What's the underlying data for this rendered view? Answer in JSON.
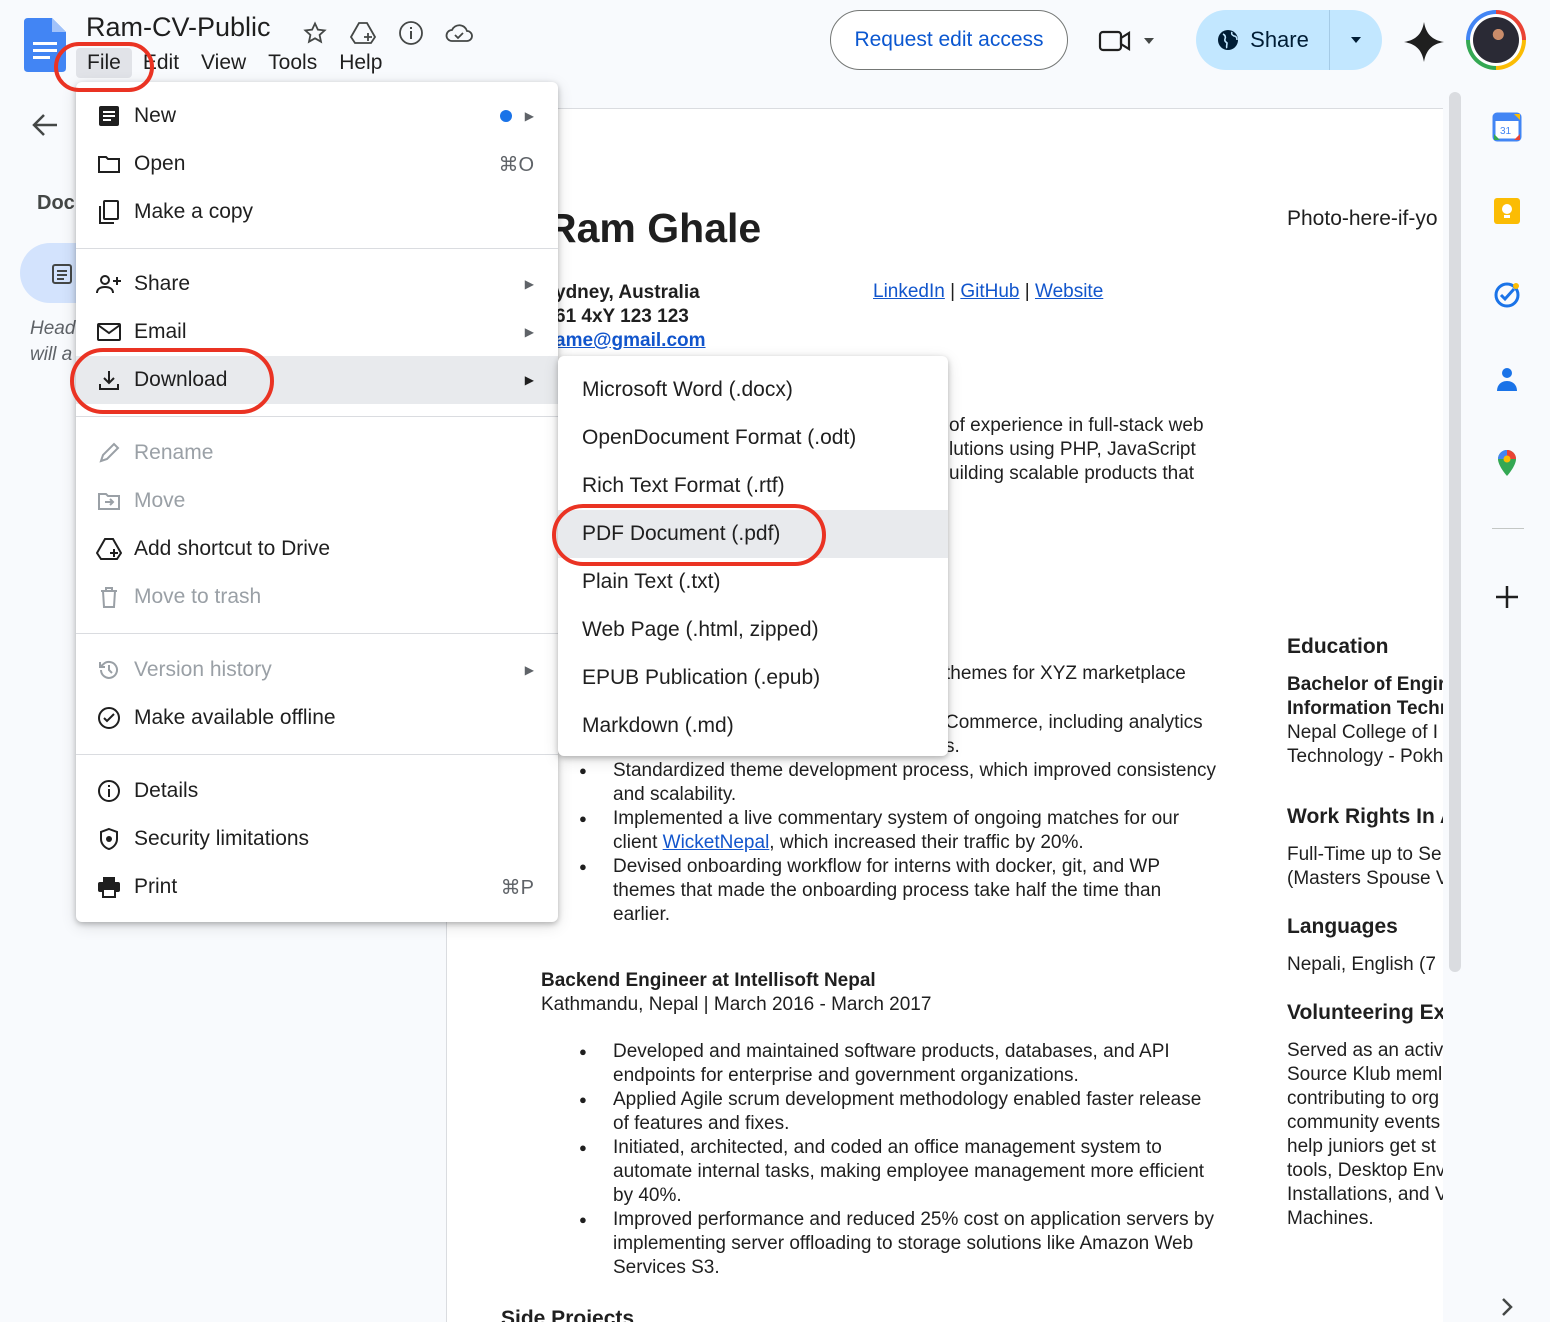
{
  "app": {
    "doc_title": "Ram-CV-Public",
    "menu": [
      "File",
      "Edit",
      "View",
      "Tools",
      "Help"
    ],
    "request_edit_label": "Request edit access",
    "share_label": "Share"
  },
  "left_panel": {
    "tab_label": "Doc",
    "hint_line1": "Head",
    "hint_line2": "will a"
  },
  "document": {
    "name": "Ram Ghale",
    "photo_hint": "Photo-here-if-yo",
    "location": "ydney, Australia",
    "phone": "61 4xY 123 123",
    "email": "ame@gmail.com",
    "links": [
      "LinkedIn",
      "GitHub",
      "Website"
    ],
    "summary": [
      "of experience in full-stack web",
      "lutions using PHP, JavaScript",
      "uilding scalable products that"
    ],
    "fragment1": "themes for XYZ marketplace",
    "fragment2a": "Commerce, including analytics",
    "fragment2b": "s.",
    "bullets1": [
      "Standardized theme development process, which improved consistency and scalability.",
      "Devised onboarding workflow for interns with docker, git, and WP themes that made the onboarding process take half the time than earlier."
    ],
    "bullet_wicket_pre": "Implemented a live commentary system of ongoing matches for our client ",
    "bullet_wicket_link": "WicketNepal",
    "bullet_wicket_post": ", which increased their traffic by 20%.",
    "job2_title": "Backend Engineer at Intellisoft Nepal",
    "job2_meta": "Kathmandu, Nepal | March 2016 - March 2017",
    "bullets2": [
      "Developed and maintained software products, databases, and API endpoints for enterprise and government organizations.",
      "Applied Agile scrum development methodology enabled faster release of features and fixes.",
      "Initiated, architected, and coded an office management system to automate internal tasks, making employee management more efficient by 40%.",
      "Improved performance and reduced 25% cost on application servers by implementing server offloading to storage solutions like Amazon Web Services S3."
    ],
    "side_projects": "Side Projects",
    "right_col": {
      "education_h": "Education",
      "edu_l1": "Bachelor of Engir",
      "edu_l2": "Information Techı",
      "edu_l3": "Nepal College of I",
      "edu_l4": "Technology - Pokh",
      "work_h": "Work Rights In A",
      "work_l1": "Full-Time up to Se",
      "work_l2": "(Masters Spouse V",
      "lang_h": "Languages",
      "lang_l1": "Nepali, English (7",
      "vol_h": "Volunteering Ex",
      "vol_lines": [
        "Served as an activ",
        "Source Klub meml",
        "contributing to org",
        "community events",
        "help juniors get st",
        "tools, Desktop Env",
        "Installations, and V",
        "Machines."
      ]
    }
  },
  "file_menu": {
    "items": [
      {
        "label": "New"
      },
      {
        "label": "Open",
        "shortcut": "⌘O"
      },
      {
        "label": "Make a copy"
      },
      {
        "label": "Share"
      },
      {
        "label": "Email"
      },
      {
        "label": "Download"
      },
      {
        "label": "Rename"
      },
      {
        "label": "Move"
      },
      {
        "label": "Add shortcut to Drive"
      },
      {
        "label": "Move to trash"
      },
      {
        "label": "Version history"
      },
      {
        "label": "Make available offline"
      },
      {
        "label": "Details"
      },
      {
        "label": "Security limitations"
      },
      {
        "label": "Print",
        "shortcut": "⌘P"
      }
    ]
  },
  "download_menu": {
    "items": [
      "Microsoft Word (.docx)",
      "OpenDocument Format (.odt)",
      "Rich Text Format (.rtf)",
      "PDF Document (.pdf)",
      "Plain Text (.txt)",
      "Web Page (.html, zipped)",
      "EPUB Publication (.epub)",
      "Markdown (.md)"
    ]
  },
  "colors": {
    "accent": "#0b57d0",
    "share_bg": "#c2e7ff",
    "annotation": "#ea3323"
  }
}
